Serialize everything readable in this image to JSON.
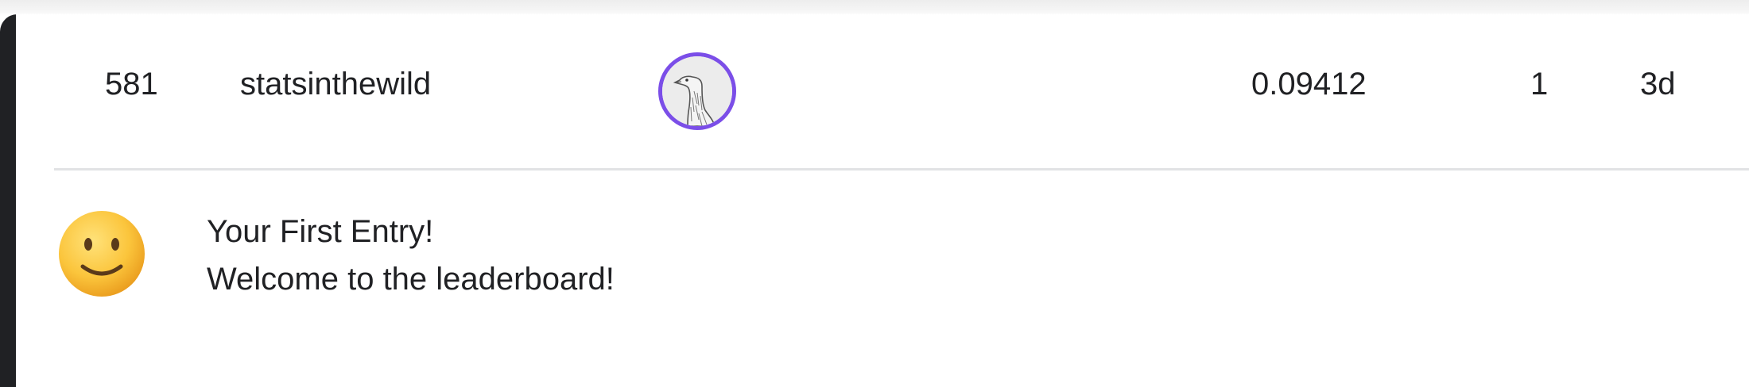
{
  "row": {
    "rank": "581",
    "team_name": "statsinthewild",
    "avatar_icon": "goose-avatar-icon",
    "avatar_ring_color": "#7b4ee8",
    "score": "0.09412",
    "entries": "1",
    "last_submission": "3d"
  },
  "message": {
    "icon": "slightly-smiling-face-emoji",
    "title": "Your First Entry!",
    "body": "Welcome to the leaderboard!"
  }
}
